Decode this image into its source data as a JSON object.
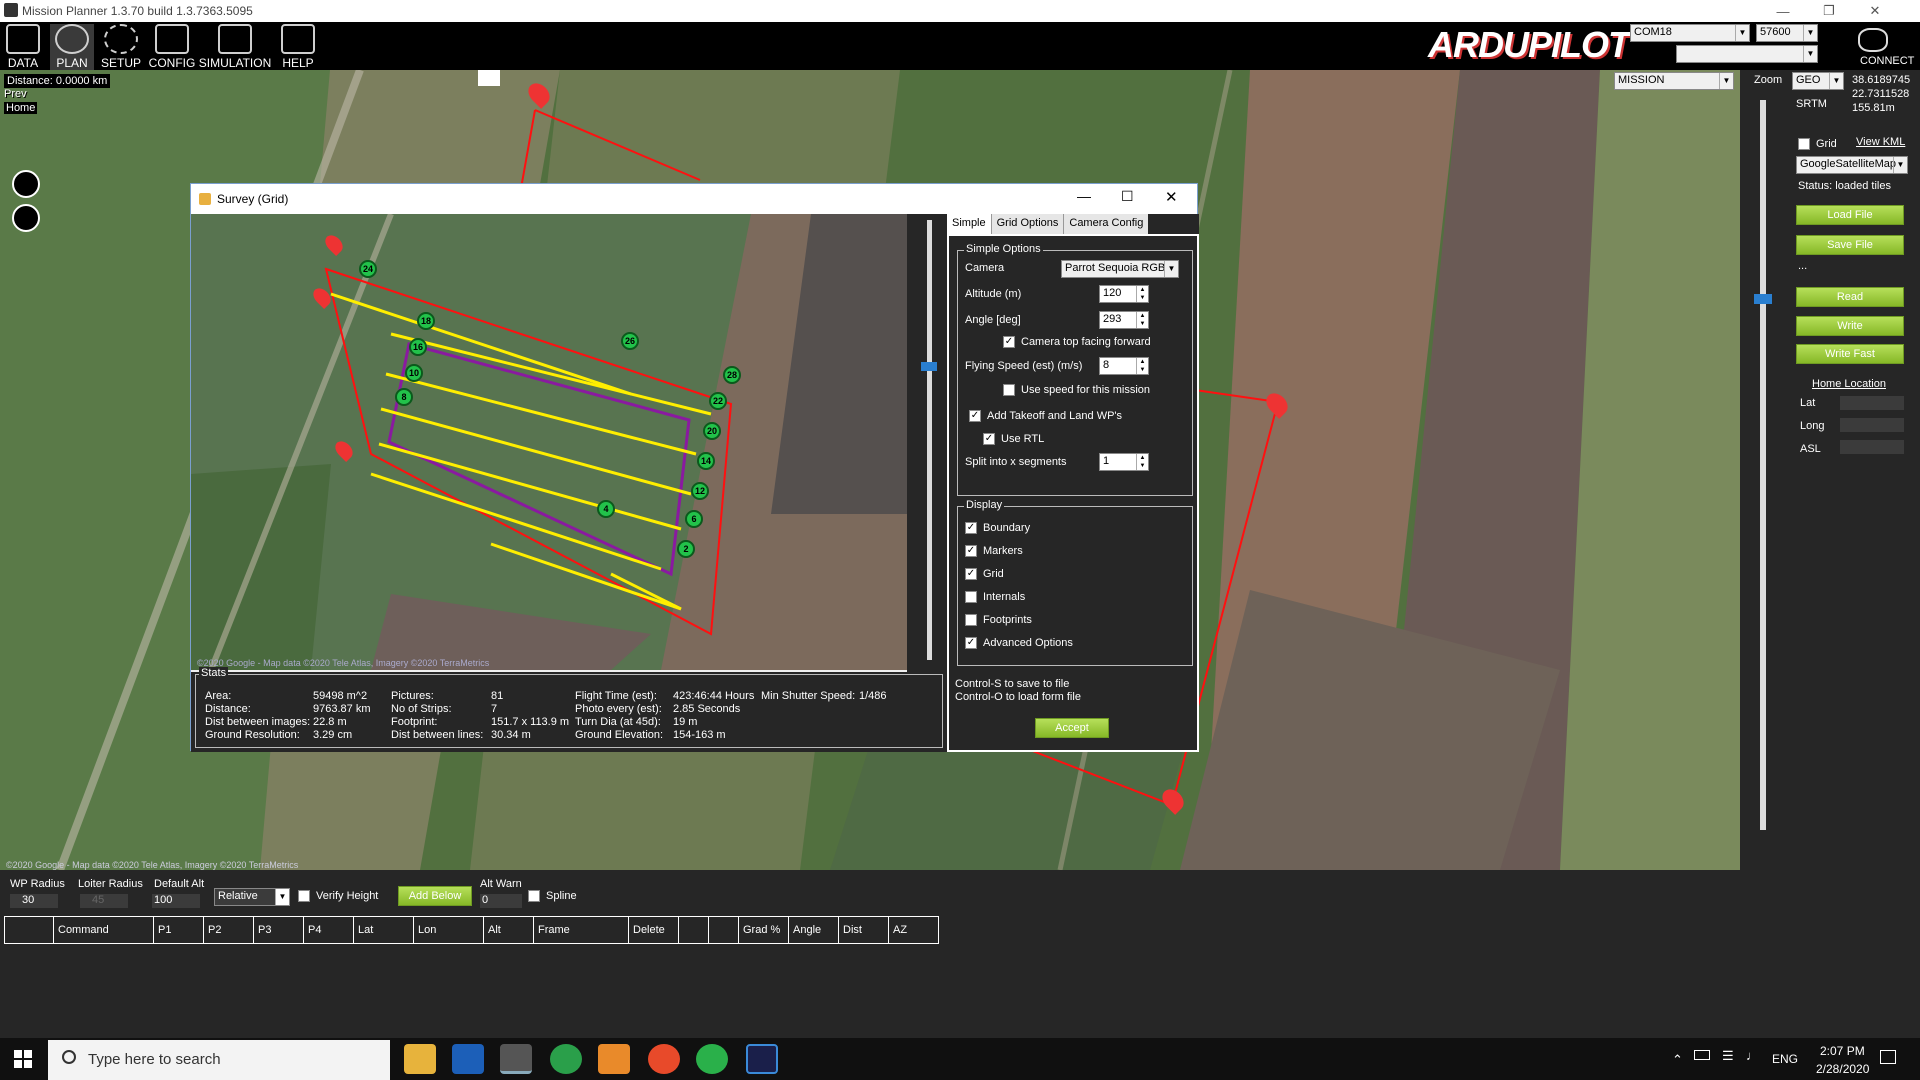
{
  "window": {
    "title": "Mission Planner 1.3.70 build 1.3.7363.5095"
  },
  "toolbar": {
    "items": [
      {
        "label": "DATA",
        "icon": "monitor-icon"
      },
      {
        "label": "PLAN",
        "icon": "globe-icon"
      },
      {
        "label": "SETUP",
        "icon": "gears-icon"
      },
      {
        "label": "CONFIG",
        "icon": "wrench-icon"
      },
      {
        "label": "SIMULATION",
        "icon": "simulation-icon"
      },
      {
        "label": "HELP",
        "icon": "help-icon"
      }
    ],
    "logo": "ARDUPILOT",
    "port": "COM18",
    "baud": "57600",
    "connect": "CONNECT"
  },
  "map": {
    "distance": "Distance: 0.0000 km",
    "prev": "Prev",
    "home": "Home",
    "mode": "MISSION",
    "zoom_label": "Zoom",
    "copyright": "©2020 Google - Map data ©2020 Tele Atlas, Imagery ©2020 TerraMetrics"
  },
  "right": {
    "coord_mode": "GEO",
    "lat": "38.6189745",
    "lon": "22.7311528",
    "alt": "155.81m",
    "srtm": "SRTM",
    "grid": "Grid",
    "view_kml": "View KML",
    "map_provider": "GoogleSatelliteMap",
    "status": "Status: loaded tiles",
    "load_file": "Load File",
    "save_file": "Save File",
    "ellipsis": "...",
    "read": "Read",
    "write": "Write",
    "write_fast": "Write Fast",
    "home_location": "Home Location",
    "lat_label": "Lat",
    "long_label": "Long",
    "asl_label": "ASL"
  },
  "survey": {
    "title": "Survey (Grid)",
    "tabs": [
      "Simple",
      "Grid Options",
      "Camera Config"
    ],
    "simple_options": "Simple Options",
    "camera_label": "Camera",
    "camera": "Parrot Sequoia RGB",
    "altitude_label": "Altitude (m)",
    "altitude": "120",
    "angle_label": "Angle [deg]",
    "angle": "293",
    "camera_top": "Camera top facing forward",
    "speed_label": "Flying Speed (est) (m/s)",
    "speed": "8",
    "use_speed": "Use speed for this mission",
    "add_takeoff": "Add Takeoff and Land WP's",
    "use_rtl": "Use RTL",
    "split_label": "Split into x segments",
    "split": "1",
    "display": "Display",
    "display_items": [
      {
        "label": "Boundary",
        "checked": "✓"
      },
      {
        "label": "Markers",
        "checked": "✓"
      },
      {
        "label": "Grid",
        "checked": "✓"
      },
      {
        "label": "Internals",
        "checked": ""
      },
      {
        "label": "Footprints",
        "checked": ""
      },
      {
        "label": "Advanced Options",
        "checked": "✓"
      }
    ],
    "hint1": "Control-S to save to file",
    "hint2": "Control-O to load form file",
    "accept": "Accept",
    "copyright": "©2020 Google - Map data ©2020 Tele Atlas, Imagery ©2020 TerraMetrics",
    "stats_title": "Stats",
    "stats": {
      "col1": [
        [
          "Area:",
          "59498 m^2"
        ],
        [
          "Distance:",
          "9763.87 km"
        ],
        [
          "Dist between images:",
          "22.8 m"
        ],
        [
          "Ground Resolution:",
          "3.29 cm"
        ]
      ],
      "col2": [
        [
          "Pictures:",
          "81"
        ],
        [
          "No of Strips:",
          "7"
        ],
        [
          "Footprint:",
          "151.7 x 113.9 m"
        ],
        [
          "Dist between lines:",
          "30.34 m"
        ]
      ],
      "col3": [
        [
          "Flight Time (est):",
          "423:46:44 Hours"
        ],
        [
          "Photo every (est):",
          "2.85 Seconds"
        ],
        [
          "Turn Dia (at 45d):",
          "19 m"
        ],
        [
          "Ground Elevation:",
          "154-163 m"
        ]
      ],
      "min_shutter_label": "Min Shutter Speed:",
      "min_shutter": "1/486"
    },
    "markers": [
      "24",
      "18",
      "16",
      "10",
      "8",
      "26",
      "28",
      "22",
      "20",
      "14",
      "12",
      "6",
      "4",
      "2"
    ]
  },
  "bottom": {
    "wp_radius_label": "WP Radius",
    "wp_radius": "30",
    "loiter_label": "Loiter Radius",
    "loiter": "45",
    "default_alt_label": "Default Alt",
    "default_alt": "100",
    "frame": "Relative",
    "verify_height": "Verify Height",
    "add_below": "Add Below",
    "alt_warn_label": "Alt Warn",
    "alt_warn": "0",
    "spline": "Spline",
    "columns": [
      "",
      "Command",
      "P1",
      "P2",
      "P3",
      "P4",
      "Lat",
      "Lon",
      "Alt",
      "Frame",
      "Delete",
      "",
      "",
      "Grad %",
      "Angle",
      "Dist",
      "AZ"
    ]
  },
  "taskbar": {
    "search_placeholder": "Type here to search",
    "time": "2:07 PM",
    "date": "2/28/2020",
    "lang": "ENG"
  }
}
